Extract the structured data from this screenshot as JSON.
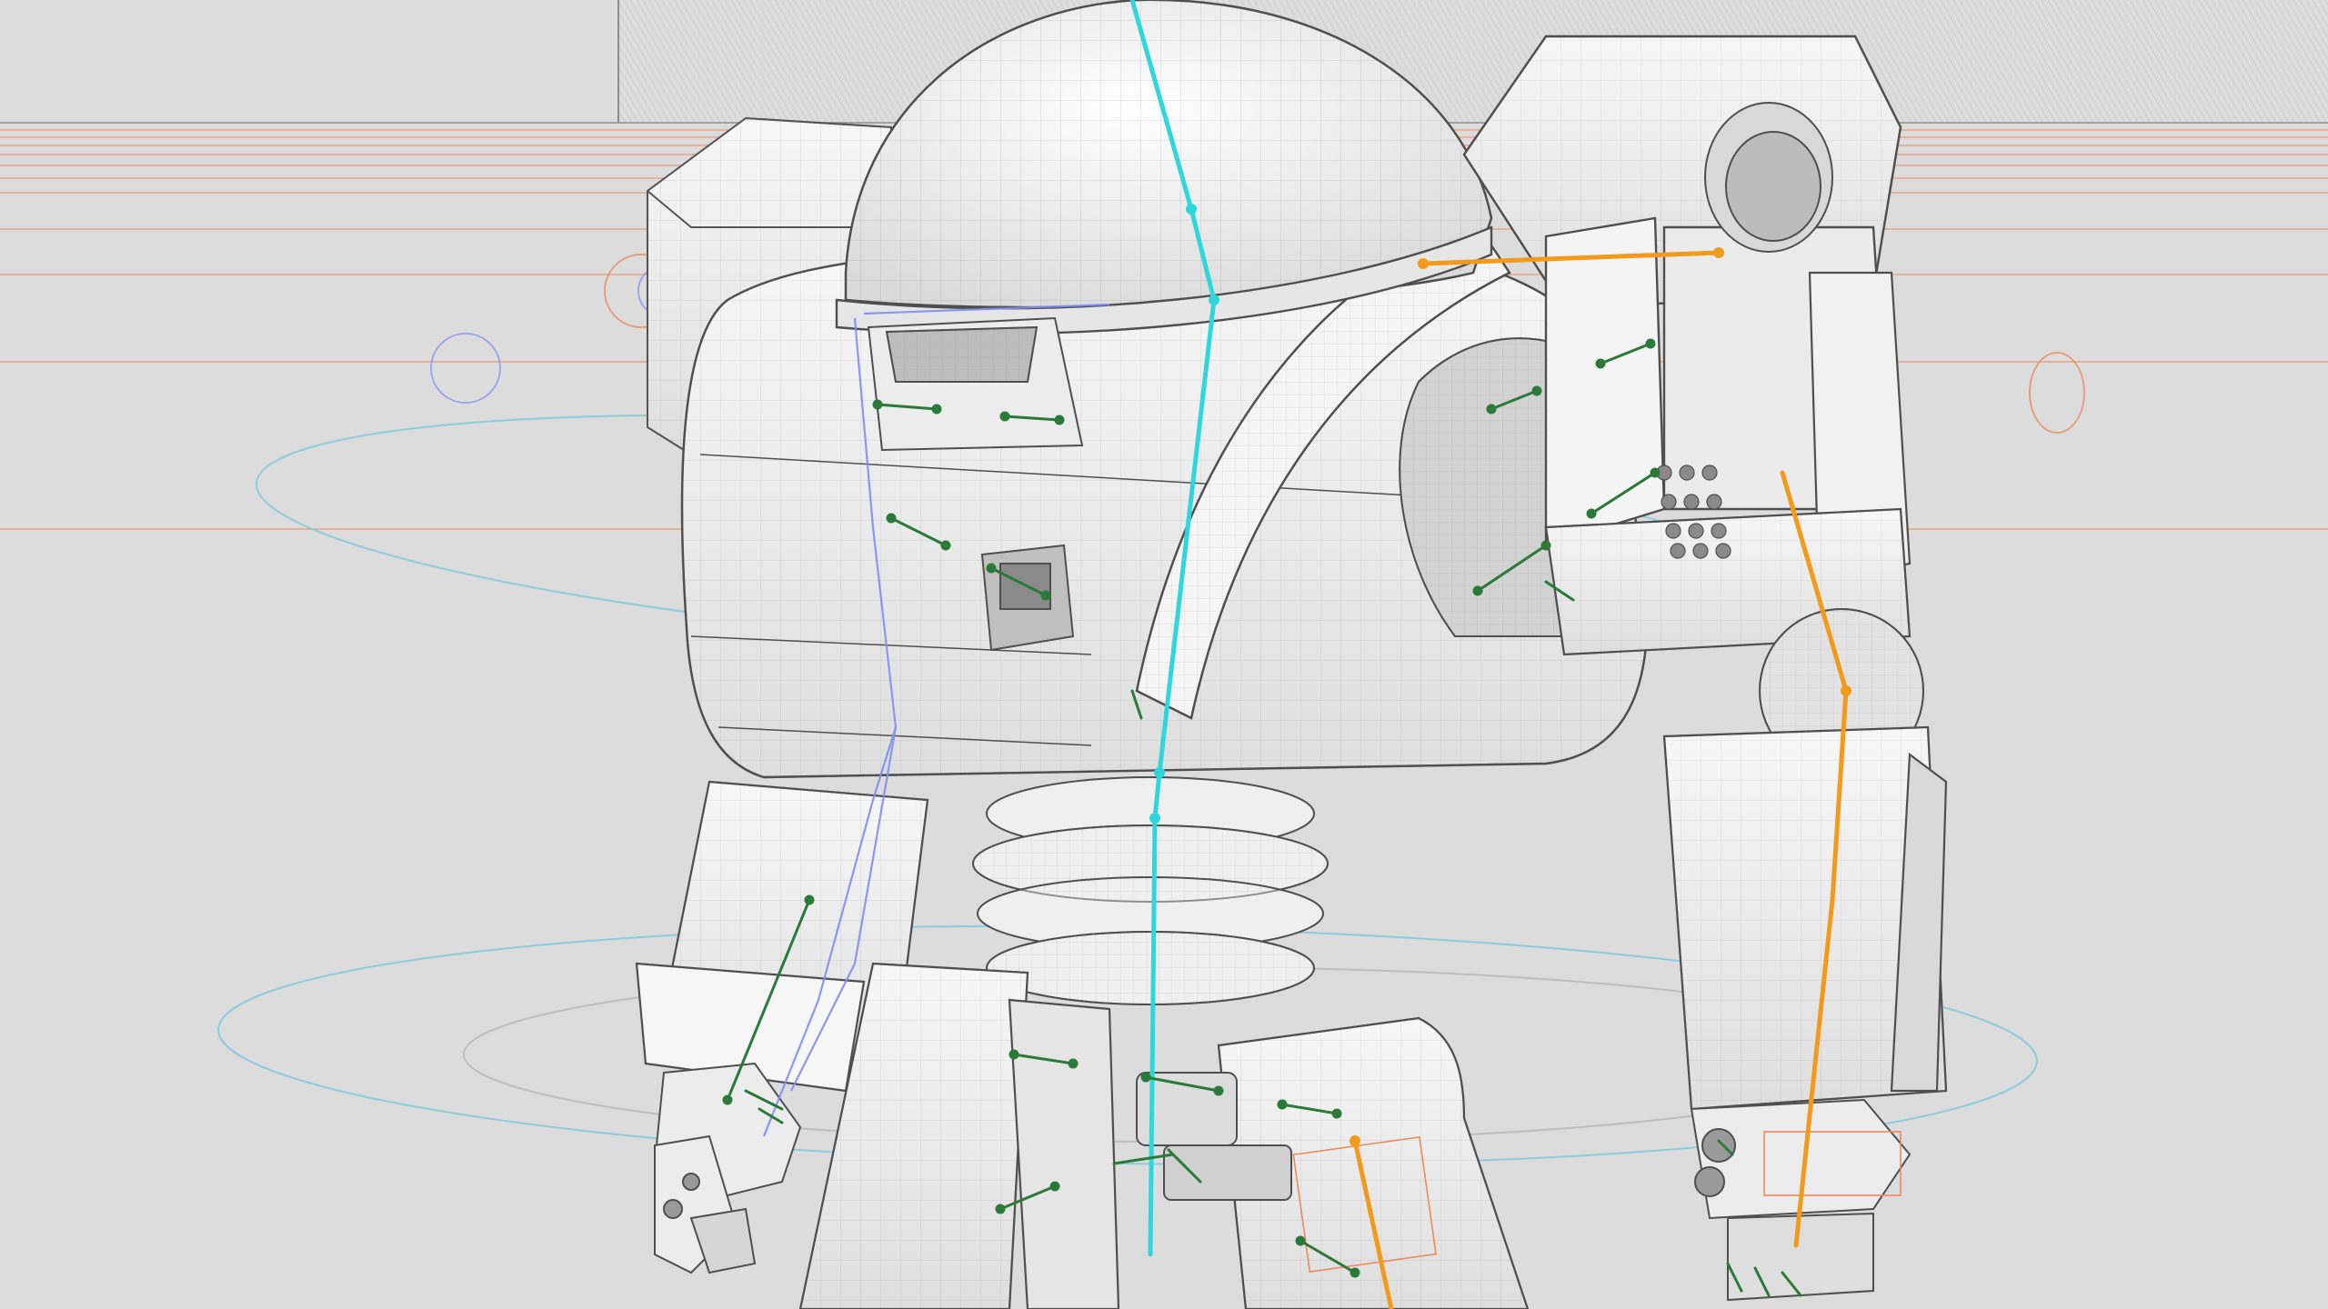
{
  "viewport": {
    "mode": "wireframe-shaded",
    "subject": "robot-rig"
  },
  "colors": {
    "background": "#dcdcdc",
    "background_dark": "#cfcfcf",
    "shell_fill": "#f3f3f3",
    "shell_shadow": "#d9d9d9",
    "shell_deep": "#a9a9a9",
    "wire": "#6a6a6a",
    "spine_bone": "#2fd6dc",
    "arm_bone": "#f19a1c",
    "joint_bone": "#2b7a3a",
    "ik_guide": "#7f8ef0",
    "orange_guide": "#ea8a5e",
    "cyan_control": "#7fc9dc"
  },
  "icons": {
    "joint_marker": "joint-marker-icon"
  }
}
